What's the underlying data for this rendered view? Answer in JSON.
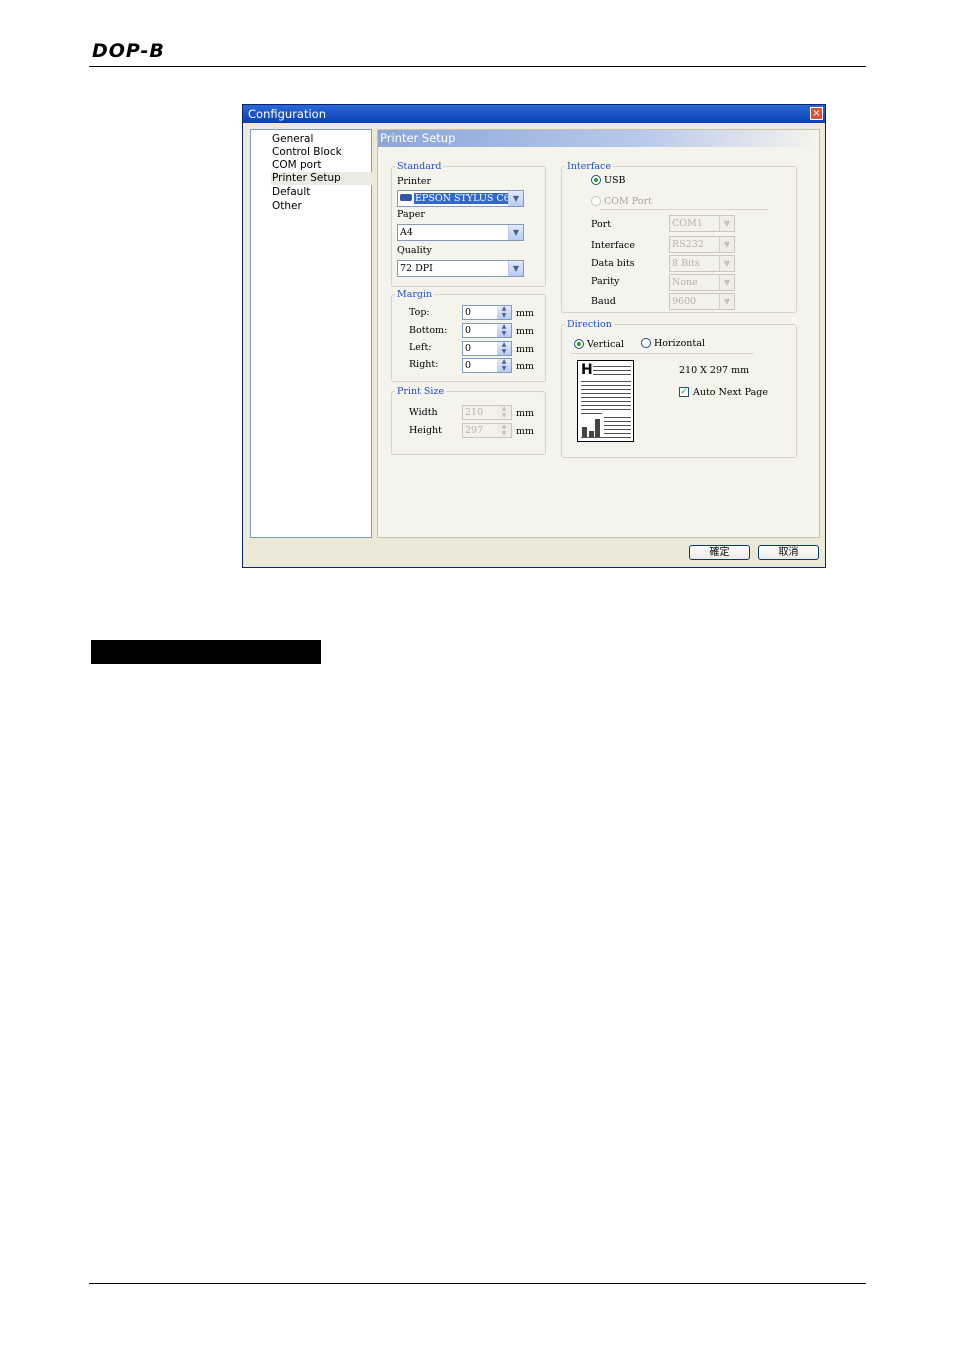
{
  "page": {
    "logo": "DOP-B"
  },
  "dialog": {
    "title": "Configuration",
    "close_glyph": "×",
    "nav_items": [
      "General",
      "Control Block",
      "COM port",
      "Printer Setup",
      "Default",
      "Other"
    ],
    "selected_nav": "Printer Setup",
    "panel_title": "Printer Setup",
    "standard": {
      "legend": "Standard",
      "printer_label": "Printer",
      "printer_value": "EPSON STYLUS C65",
      "paper_label": "Paper",
      "paper_value": "A4",
      "quality_label": "Quality",
      "quality_value": "72 DPI"
    },
    "margin": {
      "legend": "Margin",
      "top_label": "Top:",
      "top_value": "0",
      "bottom_label": "Bottom:",
      "bottom_value": "0",
      "left_label": "Left:",
      "left_value": "0",
      "right_label": "Right:",
      "right_value": "0",
      "unit": "mm"
    },
    "print_size": {
      "legend": "Print Size",
      "width_label": "Width",
      "width_value": "210",
      "height_label": "Height",
      "height_value": "297",
      "unit": "mm"
    },
    "interface": {
      "legend": "Interface",
      "usb_label": "USB",
      "com_port_label": "COM Port",
      "port_label": "Port",
      "port_value": "COM1",
      "interface_label": "Interface",
      "interface_value": "RS232",
      "data_bits_label": "Data bits",
      "data_bits_value": "8 Bits",
      "parity_label": "Parity",
      "parity_value": "None",
      "baud_label": "Baud",
      "baud_value": "9600",
      "selected": "USB"
    },
    "direction": {
      "legend": "Direction",
      "vertical_label": "Vertical",
      "horizontal_label": "Horizontal",
      "selected": "Vertical",
      "page_size_text": "210 X 297 mm",
      "auto_next_page_label": "Auto Next Page",
      "auto_next_page_checked": true,
      "preview_letter": "H"
    },
    "buttons": {
      "ok_label": "確定",
      "cancel_label": "取消"
    }
  }
}
